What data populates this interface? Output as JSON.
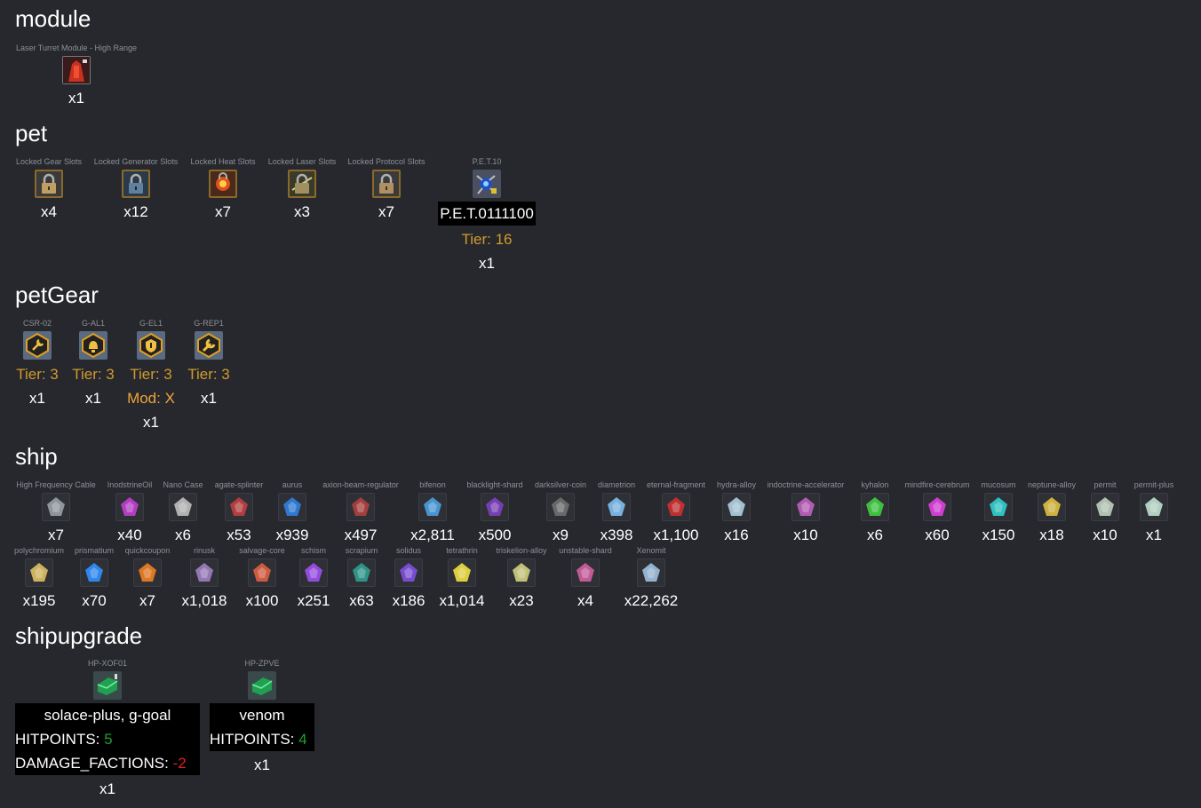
{
  "sections": {
    "module": {
      "title": "module",
      "items": [
        {
          "name": "Laser Turret Module - High Range",
          "count": "x1",
          "icon": "laser-turret-icon"
        }
      ]
    },
    "pet": {
      "title": "pet",
      "items": [
        {
          "name": "Locked Gear Slots",
          "count": "x4",
          "icon": "lock-icon"
        },
        {
          "name": "Locked Generator Slots",
          "count": "x12",
          "icon": "lock-icon"
        },
        {
          "name": "Locked Heat Slots",
          "count": "x7",
          "icon": "heat-icon"
        },
        {
          "name": "Locked Laser Slots",
          "count": "x3",
          "icon": "lock-icon"
        },
        {
          "name": "Locked Protocol Slots",
          "count": "x7",
          "icon": "lock-icon"
        },
        {
          "name": "P.E.T.10",
          "label": "P.E.T.0111100",
          "tier": "Tier: 16",
          "count": "x1",
          "icon": "pet-drone-icon"
        }
      ]
    },
    "petGear": {
      "title": "petGear",
      "items": [
        {
          "name": "CSR-02",
          "tier": "Tier: 3",
          "count": "x1",
          "icon": "wrench-gear-icon"
        },
        {
          "name": "G-AL1",
          "tier": "Tier: 3",
          "count": "x1",
          "icon": "alarm-gear-icon"
        },
        {
          "name": "G-EL1",
          "tier": "Tier: 3",
          "mod": "Mod: X",
          "count": "x1",
          "icon": "shield-gear-icon"
        },
        {
          "name": "G-REP1",
          "tier": "Tier: 3",
          "count": "x1",
          "icon": "repair-gear-icon"
        }
      ]
    },
    "ship": {
      "title": "ship",
      "row1": [
        {
          "name": "High Frequency Cable",
          "count": "x7",
          "color": "#9aa0a8"
        },
        {
          "name": "InodstrineOil",
          "count": "x40",
          "color": "#c040d0"
        },
        {
          "name": "Nano Case",
          "count": "x6",
          "color": "#c0c0c0"
        },
        {
          "name": "agate-splinter",
          "count": "x53",
          "color": "#c04040"
        },
        {
          "name": "aurus",
          "count": "x939",
          "color": "#3080e0"
        },
        {
          "name": "axion-beam-regulator",
          "count": "x497",
          "color": "#b04040"
        },
        {
          "name": "bifenon",
          "count": "x2,811",
          "color": "#4aa0e0"
        },
        {
          "name": "blacklight-shard",
          "count": "x500",
          "color": "#8040c0"
        },
        {
          "name": "darksilver-coin",
          "count": "x9",
          "color": "#707070"
        },
        {
          "name": "diametrion",
          "count": "x398",
          "color": "#80c0f0"
        },
        {
          "name": "eternal-fragment",
          "count": "x1,100",
          "color": "#d03030"
        },
        {
          "name": "hydra-alloy",
          "count": "x16",
          "color": "#b0d0e0"
        },
        {
          "name": "indoctrine-accelerator",
          "count": "x10",
          "color": "#c060c0"
        },
        {
          "name": "kyhalon",
          "count": "x6",
          "color": "#40d040"
        },
        {
          "name": "mindfire-cerebrum",
          "count": "x60",
          "color": "#e040e0"
        },
        {
          "name": "mucosum",
          "count": "x150",
          "color": "#30d0d0"
        },
        {
          "name": "neptune-alloy",
          "count": "x18",
          "color": "#e0c040"
        },
        {
          "name": "permit",
          "count": "x10",
          "color": "#c0d0c0"
        },
        {
          "name": "permit-plus",
          "count": "x1",
          "color": "#c0e0d0"
        }
      ],
      "row2": [
        {
          "name": "polychromium",
          "count": "x195",
          "color": "#e0c060"
        },
        {
          "name": "prismatium",
          "count": "x70",
          "color": "#3090ff"
        },
        {
          "name": "quickcoupon",
          "count": "x7",
          "color": "#f08020"
        },
        {
          "name": "rinusk",
          "count": "x1,018",
          "color": "#a080c0"
        },
        {
          "name": "salvage-core",
          "count": "x100",
          "color": "#e06040"
        },
        {
          "name": "schism",
          "count": "x251",
          "color": "#a050f0"
        },
        {
          "name": "scrapium",
          "count": "x63",
          "color": "#30a090"
        },
        {
          "name": "solidus",
          "count": "x186",
          "color": "#8050e0"
        },
        {
          "name": "tetrathrin",
          "count": "x1,014",
          "color": "#f0e040"
        },
        {
          "name": "triskelion-alloy",
          "count": "x23",
          "color": "#d0d080"
        },
        {
          "name": "unstable-shard",
          "count": "x4",
          "color": "#d060a0"
        },
        {
          "name": "Xenomit",
          "count": "x22,262",
          "color": "#a0c0e0"
        }
      ]
    },
    "shipupgrade": {
      "title": "shipupgrade",
      "items": [
        {
          "name": "HP-XOF01",
          "label": "solace-plus, g-goal",
          "hp_label": "HITPOINTS: ",
          "hp_value": "5",
          "dmg_label": "DAMAGE_FACTIONS: ",
          "dmg_value": "-2",
          "count": "x1",
          "icon": "hull-upgrade-icon"
        },
        {
          "name": "HP-ZPVE",
          "label": "venom",
          "hp_label": "HITPOINTS: ",
          "hp_value": "4",
          "count": "x1",
          "icon": "hull-upgrade-icon"
        }
      ]
    }
  },
  "colors": {
    "background": "#26282d",
    "tier": "#d29a2d",
    "mod": "#f0a53a",
    "positive": "#1fa02f",
    "negative": "#e02020"
  }
}
